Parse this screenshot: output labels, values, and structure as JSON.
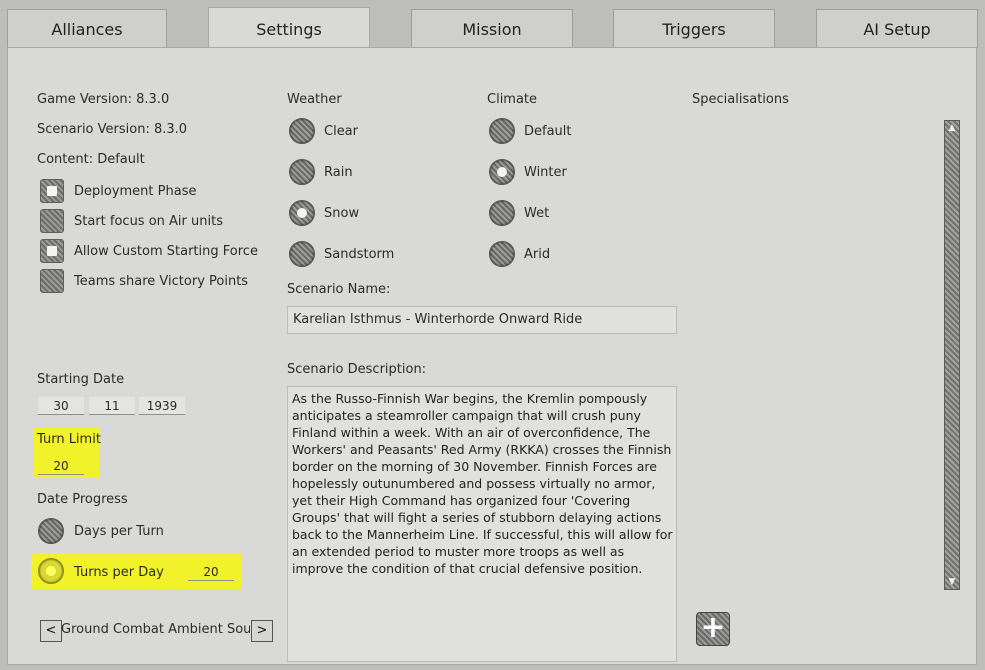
{
  "tabs": [
    {
      "label": "Alliances"
    },
    {
      "label": "Settings"
    },
    {
      "label": "Mission"
    },
    {
      "label": "Triggers"
    },
    {
      "label": "AI Setup"
    }
  ],
  "active_tab": "Settings",
  "info": {
    "game_version": "Game Version: 8.3.0",
    "scenario_version": "Scenario Version: 8.3.0",
    "content": "Content: Default"
  },
  "checkboxes": [
    {
      "label": "Deployment Phase",
      "checked": true
    },
    {
      "label": "Start focus on Air units",
      "checked": false
    },
    {
      "label": "Allow Custom Starting Force",
      "checked": true
    },
    {
      "label": "Teams share Victory Points",
      "checked": false
    }
  ],
  "starting_date": {
    "label": "Starting Date",
    "day": "30",
    "month": "11",
    "year": "1939"
  },
  "turn_limit": {
    "label": "Turn Limit",
    "value": "20"
  },
  "date_progress": {
    "label": "Date Progress",
    "options": [
      {
        "label": "Days per Turn",
        "selected": false
      },
      {
        "label": "Turns per Day",
        "selected": true,
        "value": "20"
      }
    ]
  },
  "sound": {
    "label": "Ground Combat Ambient Sound",
    "prev": "<",
    "next": ">"
  },
  "weather": {
    "label": "Weather",
    "options": [
      {
        "label": "Clear",
        "selected": false
      },
      {
        "label": "Rain",
        "selected": false
      },
      {
        "label": "Snow",
        "selected": true
      },
      {
        "label": "Sandstorm",
        "selected": false
      }
    ]
  },
  "climate": {
    "label": "Climate",
    "options": [
      {
        "label": "Default",
        "selected": false
      },
      {
        "label": "Winter",
        "selected": true
      },
      {
        "label": "Wet",
        "selected": false
      },
      {
        "label": "Arid",
        "selected": false
      }
    ]
  },
  "scenario_name": {
    "label": "Scenario Name:",
    "value": "Karelian Isthmus - Winterhorde Onward Ride"
  },
  "scenario_description": {
    "label": "Scenario Description:",
    "value": "As the Russo-Finnish War begins, the Kremlin pompously anticipates a steamroller campaign that will crush puny Finland within a week. With an air of overconfidence, The Workers' and Peasants' Red Army (RKKA) crosses the Finnish border on the morning of 30 November. Finnish Forces are hopelessly outunumbered and possess virtually no armor, yet their High Command has organized four 'Covering Groups' that will fight a series of stubborn delaying actions back to the Mannerheim Line. If successful, this will allow for an extended period to muster more troops as well as improve the condition of that crucial defensive position."
  },
  "specialisations": {
    "label": "Specialisations",
    "add_icon": "plus-icon"
  },
  "scroll": {
    "up": "▲",
    "down": "▼"
  },
  "add_symbol": "+",
  "colors": {
    "highlight": "#f2f22a",
    "panel": "#d9d9d7"
  }
}
